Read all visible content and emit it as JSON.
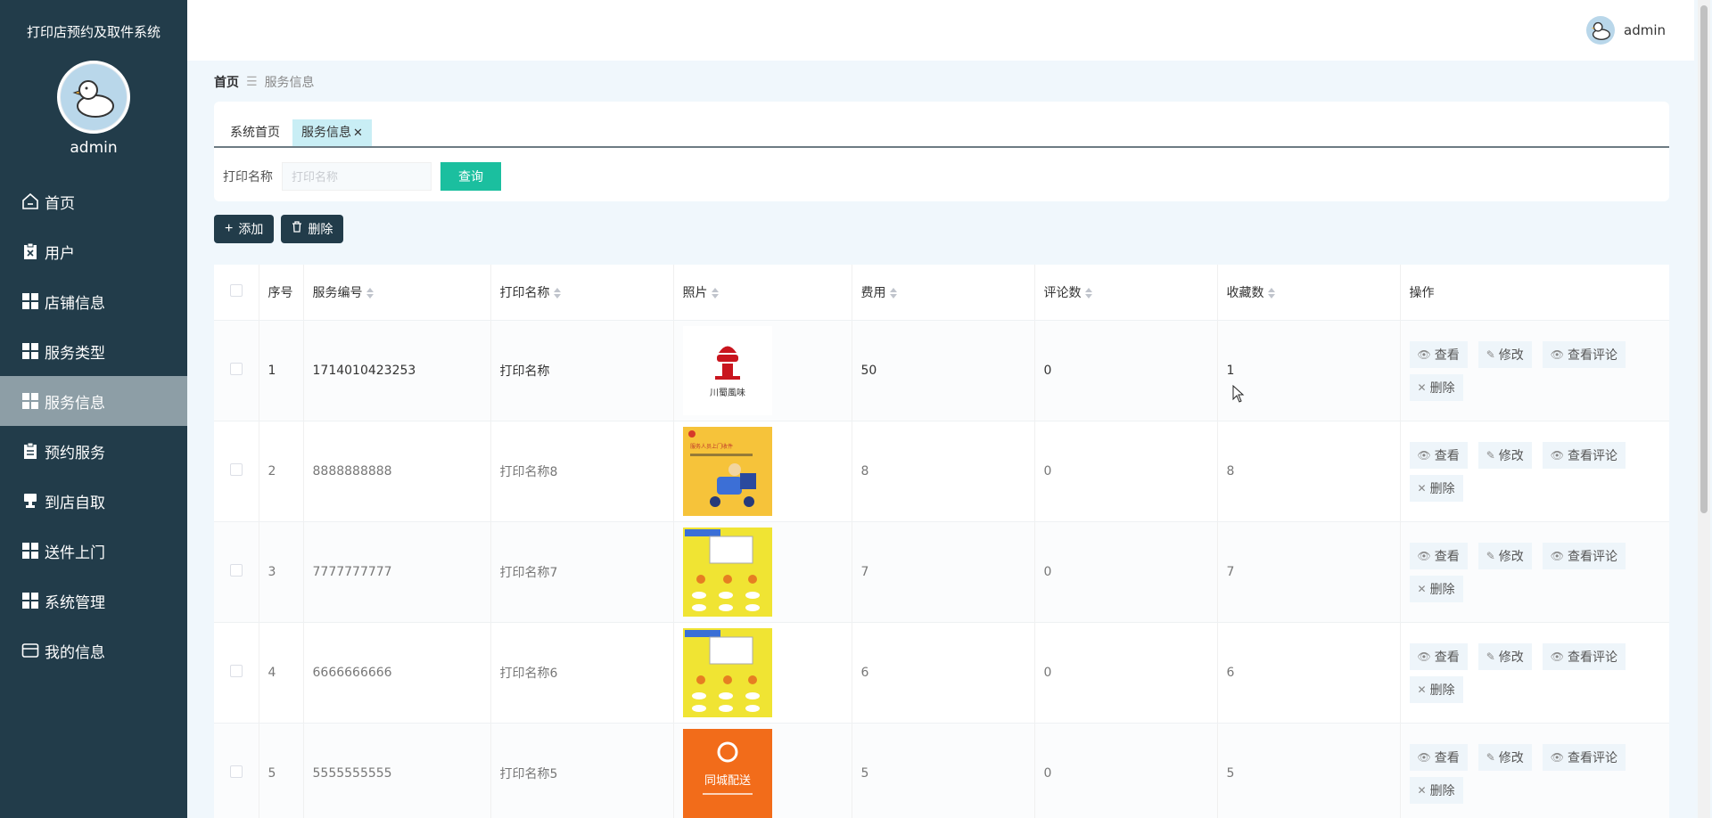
{
  "app": {
    "title": "打印店预约及取件系统",
    "username": "admin"
  },
  "sidebar": {
    "items": [
      {
        "label": "首页",
        "icon": "home-icon"
      },
      {
        "label": "用户",
        "icon": "clipboard-x-icon"
      },
      {
        "label": "店铺信息",
        "icon": "grid-icon"
      },
      {
        "label": "服务类型",
        "icon": "grid-icon"
      },
      {
        "label": "服务信息",
        "icon": "grid-icon",
        "active": true
      },
      {
        "label": "预约服务",
        "icon": "clipboard-icon"
      },
      {
        "label": "到店自取",
        "icon": "stamp-icon"
      },
      {
        "label": "送件上门",
        "icon": "grid-icon"
      },
      {
        "label": "系统管理",
        "icon": "grid-icon"
      },
      {
        "label": "我的信息",
        "icon": "card-icon"
      }
    ]
  },
  "topbar": {
    "username": "admin"
  },
  "breadcrumb": {
    "home": "首页",
    "separator": "☰",
    "current": "服务信息"
  },
  "tabs": [
    {
      "label": "系统首页"
    },
    {
      "label": "服务信息",
      "close": "✕"
    }
  ],
  "search": {
    "label": "打印名称",
    "placeholder": "打印名称",
    "value": "",
    "button": "查询"
  },
  "actions": {
    "add": "添加",
    "delete": "删除"
  },
  "table": {
    "headers": {
      "index": "序号",
      "code": "服务编号",
      "name": "打印名称",
      "photo": "照片",
      "fee": "费用",
      "comments": "评论数",
      "favorites": "收藏数",
      "ops": "操作"
    },
    "op_labels": {
      "view": "查看",
      "edit": "修改",
      "view_comments": "查看评论",
      "delete": "删除"
    },
    "rows": [
      {
        "index": "1",
        "code": "1714010423253",
        "name": "打印名称",
        "fee": "50",
        "comments": "0",
        "favorites": "1",
        "photo_text": "川蜀風味"
      },
      {
        "index": "2",
        "code": "8888888888",
        "name": "打印名称8",
        "fee": "8",
        "comments": "0",
        "favorites": "8",
        "photo_text": "服务人员上门收件"
      },
      {
        "index": "3",
        "code": "7777777777",
        "name": "打印名称7",
        "fee": "7",
        "comments": "0",
        "favorites": "7",
        "photo_text": ""
      },
      {
        "index": "4",
        "code": "6666666666",
        "name": "打印名称6",
        "fee": "6",
        "comments": "0",
        "favorites": "6",
        "photo_text": ""
      },
      {
        "index": "5",
        "code": "5555555555",
        "name": "打印名称5",
        "fee": "5",
        "comments": "0",
        "favorites": "5",
        "photo_text": "同城配送"
      }
    ]
  },
  "colors": {
    "sidebar_bg": "#223c4a",
    "accent": "#1bbf9f",
    "active_menu": "#8d9ea6"
  }
}
